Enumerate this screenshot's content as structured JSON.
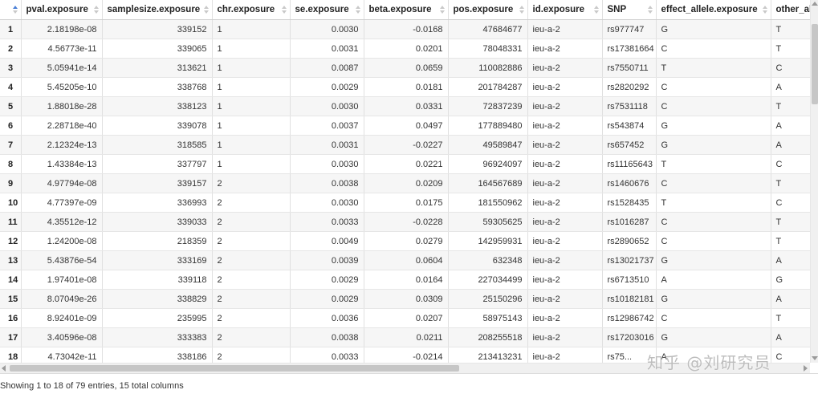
{
  "columns": [
    {
      "key": "idx",
      "label": ""
    },
    {
      "key": "pval",
      "label": "pval.exposure"
    },
    {
      "key": "samplesize",
      "label": "samplesize.exposure"
    },
    {
      "key": "chr",
      "label": "chr.exposure"
    },
    {
      "key": "se",
      "label": "se.exposure"
    },
    {
      "key": "beta",
      "label": "beta.exposure"
    },
    {
      "key": "pos",
      "label": "pos.exposure"
    },
    {
      "key": "id",
      "label": "id.exposure"
    },
    {
      "key": "snp",
      "label": "SNP"
    },
    {
      "key": "effect",
      "label": "effect_allele.exposure"
    },
    {
      "key": "other",
      "label": "other_allele.exposure"
    }
  ],
  "rows": [
    {
      "idx": "1",
      "pval": "2.18198e-08",
      "samplesize": "339152",
      "chr": "1",
      "se": "0.0030",
      "beta": "-0.0168",
      "pos": "47684677",
      "id": "ieu-a-2",
      "snp": "rs977747",
      "effect": "G",
      "other": "T"
    },
    {
      "idx": "2",
      "pval": "4.56773e-11",
      "samplesize": "339065",
      "chr": "1",
      "se": "0.0031",
      "beta": "0.0201",
      "pos": "78048331",
      "id": "ieu-a-2",
      "snp": "rs17381664",
      "effect": "C",
      "other": "T"
    },
    {
      "idx": "3",
      "pval": "5.05941e-14",
      "samplesize": "313621",
      "chr": "1",
      "se": "0.0087",
      "beta": "0.0659",
      "pos": "110082886",
      "id": "ieu-a-2",
      "snp": "rs7550711",
      "effect": "T",
      "other": "C"
    },
    {
      "idx": "4",
      "pval": "5.45205e-10",
      "samplesize": "338768",
      "chr": "1",
      "se": "0.0029",
      "beta": "0.0181",
      "pos": "201784287",
      "id": "ieu-a-2",
      "snp": "rs2820292",
      "effect": "C",
      "other": "A"
    },
    {
      "idx": "5",
      "pval": "1.88018e-28",
      "samplesize": "338123",
      "chr": "1",
      "se": "0.0030",
      "beta": "0.0331",
      "pos": "72837239",
      "id": "ieu-a-2",
      "snp": "rs7531118",
      "effect": "C",
      "other": "T"
    },
    {
      "idx": "6",
      "pval": "2.28718e-40",
      "samplesize": "339078",
      "chr": "1",
      "se": "0.0037",
      "beta": "0.0497",
      "pos": "177889480",
      "id": "ieu-a-2",
      "snp": "rs543874",
      "effect": "G",
      "other": "A"
    },
    {
      "idx": "7",
      "pval": "2.12324e-13",
      "samplesize": "318585",
      "chr": "1",
      "se": "0.0031",
      "beta": "-0.0227",
      "pos": "49589847",
      "id": "ieu-a-2",
      "snp": "rs657452",
      "effect": "G",
      "other": "A"
    },
    {
      "idx": "8",
      "pval": "1.43384e-13",
      "samplesize": "337797",
      "chr": "1",
      "se": "0.0030",
      "beta": "0.0221",
      "pos": "96924097",
      "id": "ieu-a-2",
      "snp": "rs11165643",
      "effect": "T",
      "other": "C"
    },
    {
      "idx": "9",
      "pval": "4.97794e-08",
      "samplesize": "339157",
      "chr": "2",
      "se": "0.0038",
      "beta": "0.0209",
      "pos": "164567689",
      "id": "ieu-a-2",
      "snp": "rs1460676",
      "effect": "C",
      "other": "T"
    },
    {
      "idx": "10",
      "pval": "4.77397e-09",
      "samplesize": "336993",
      "chr": "2",
      "se": "0.0030",
      "beta": "0.0175",
      "pos": "181550962",
      "id": "ieu-a-2",
      "snp": "rs1528435",
      "effect": "T",
      "other": "C"
    },
    {
      "idx": "11",
      "pval": "4.35512e-12",
      "samplesize": "339033",
      "chr": "2",
      "se": "0.0033",
      "beta": "-0.0228",
      "pos": "59305625",
      "id": "ieu-a-2",
      "snp": "rs1016287",
      "effect": "C",
      "other": "T"
    },
    {
      "idx": "12",
      "pval": "1.24200e-08",
      "samplesize": "218359",
      "chr": "2",
      "se": "0.0049",
      "beta": "0.0279",
      "pos": "142959931",
      "id": "ieu-a-2",
      "snp": "rs2890652",
      "effect": "C",
      "other": "T"
    },
    {
      "idx": "13",
      "pval": "5.43876e-54",
      "samplesize": "333169",
      "chr": "2",
      "se": "0.0039",
      "beta": "0.0604",
      "pos": "632348",
      "id": "ieu-a-2",
      "snp": "rs13021737",
      "effect": "G",
      "other": "A"
    },
    {
      "idx": "14",
      "pval": "1.97401e-08",
      "samplesize": "339118",
      "chr": "2",
      "se": "0.0029",
      "beta": "0.0164",
      "pos": "227034499",
      "id": "ieu-a-2",
      "snp": "rs6713510",
      "effect": "A",
      "other": "G"
    },
    {
      "idx": "15",
      "pval": "8.07049e-26",
      "samplesize": "338829",
      "chr": "2",
      "se": "0.0029",
      "beta": "0.0309",
      "pos": "25150296",
      "id": "ieu-a-2",
      "snp": "rs10182181",
      "effect": "G",
      "other": "A"
    },
    {
      "idx": "16",
      "pval": "8.92401e-09",
      "samplesize": "235995",
      "chr": "2",
      "se": "0.0036",
      "beta": "0.0207",
      "pos": "58975143",
      "id": "ieu-a-2",
      "snp": "rs12986742",
      "effect": "C",
      "other": "T"
    },
    {
      "idx": "17",
      "pval": "3.40596e-08",
      "samplesize": "333383",
      "chr": "2",
      "se": "0.0038",
      "beta": "0.0211",
      "pos": "208255518",
      "id": "ieu-a-2",
      "snp": "rs17203016",
      "effect": "G",
      "other": "A"
    },
    {
      "idx": "18",
      "pval": "4.73042e-11",
      "samplesize": "338186",
      "chr": "2",
      "se": "0.0033",
      "beta": "-0.0214",
      "pos": "213413231",
      "id": "ieu-a-2",
      "snp": "rs75...",
      "effect": "A",
      "other": "C"
    }
  ],
  "footer": {
    "info": "Showing 1 to 18 of 79 entries, 15 total columns"
  },
  "watermark": {
    "text": "知乎 @刘研究员"
  },
  "colors": {
    "accent": "#4a7fd6",
    "stripe": "#f6f6f6"
  }
}
